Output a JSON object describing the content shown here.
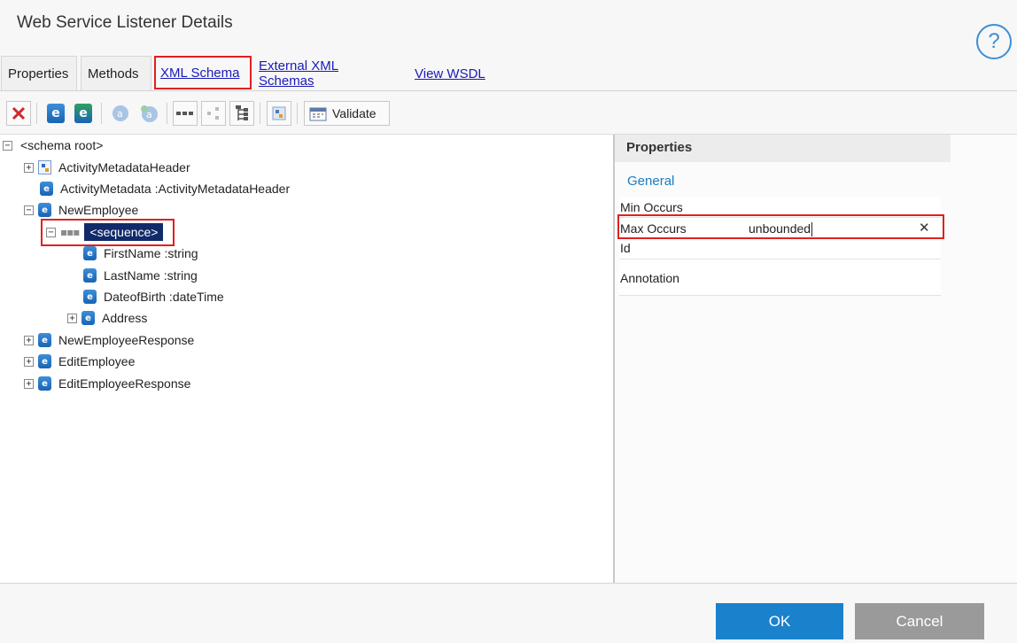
{
  "window": {
    "title": "Web Service Listener Details",
    "help_label": "?"
  },
  "tabs": [
    {
      "label": "Properties"
    },
    {
      "label": "Methods"
    },
    {
      "label": "XML Schema"
    },
    {
      "label": "External XML Schemas"
    },
    {
      "label": "View WSDL"
    }
  ],
  "toolbar": {
    "validate_label": "Validate",
    "icons": [
      "delete-icon",
      "add-element-icon",
      "add-complex-element-icon",
      "add-attribute-icon",
      "add-attribute-group-icon",
      "sequence-icon",
      "choice-icon",
      "all-icon",
      "import-icon",
      "validate-icon"
    ]
  },
  "tree": {
    "root": "<schema root>",
    "items": [
      {
        "label": "ActivityMetadataHeader"
      },
      {
        "label": "ActivityMetadata :ActivityMetadataHeader"
      },
      {
        "label": "NewEmployee"
      },
      {
        "label": "<sequence>"
      },
      {
        "label": "FirstName :string"
      },
      {
        "label": "LastName :string"
      },
      {
        "label": "DateofBirth :dateTime"
      },
      {
        "label": "Address"
      },
      {
        "label": "NewEmployeeResponse"
      },
      {
        "label": "EditEmployee"
      },
      {
        "label": "EditEmployeeResponse"
      }
    ]
  },
  "properties": {
    "header": "Properties",
    "section": "General",
    "rows": [
      {
        "label": "Min Occurs",
        "value": ""
      },
      {
        "label": "Max Occurs",
        "value": "unbounded"
      },
      {
        "label": "Id",
        "value": ""
      },
      {
        "label": "Annotation",
        "value": ""
      }
    ],
    "clear_symbol": "✕"
  },
  "footer": {
    "ok_label": "OK",
    "cancel_label": "Cancel"
  },
  "colors": {
    "accent": "#1a82cc",
    "highlight": "#e02020",
    "selection": "#112a6a",
    "link": "#1a1ab8"
  }
}
